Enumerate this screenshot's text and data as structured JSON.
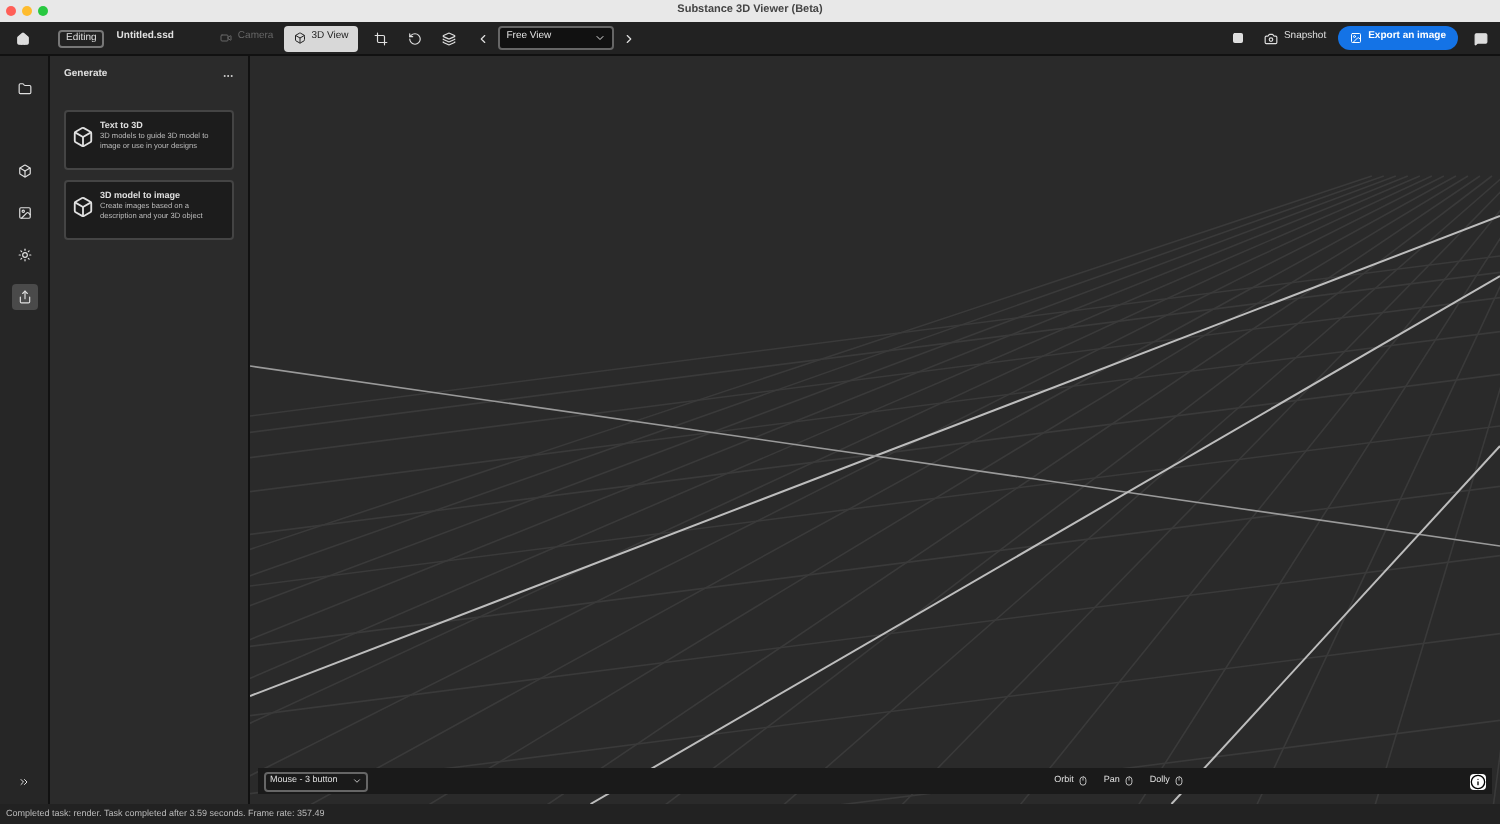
{
  "window": {
    "title": "Substance 3D Viewer (Beta)"
  },
  "toolbar": {
    "mode_badge": "Editing",
    "file_name": "Untitled.ssd",
    "camera_button": {
      "label": "Camera",
      "disabled": true
    },
    "view_button": {
      "label": "3D View",
      "selected": true
    },
    "view_select": "Free View",
    "snapshot": "Snapshot",
    "export_button": "Export an image"
  },
  "sidebar": {
    "items": [
      {
        "kind": "folder",
        "selected": false
      },
      {
        "kind": "objects",
        "selected": false
      },
      {
        "kind": "scene",
        "selected": false
      },
      {
        "kind": "light",
        "selected": false
      },
      {
        "kind": "export",
        "selected": true
      }
    ]
  },
  "panel": {
    "title": "Generate",
    "cards": [
      {
        "title": "Text to 3D",
        "description": "3D models to guide 3D model to image or use in your designs"
      },
      {
        "title": "3D model to image",
        "description": "Create images based on a description and your 3D object"
      }
    ]
  },
  "viewport": {
    "input_select": "Mouse - 3 button",
    "hints": [
      "Orbit",
      "Pan",
      "Dolly"
    ]
  },
  "status_bar": "Completed task: render. Task completed after 3.59 seconds. Frame rate: 357.49"
}
